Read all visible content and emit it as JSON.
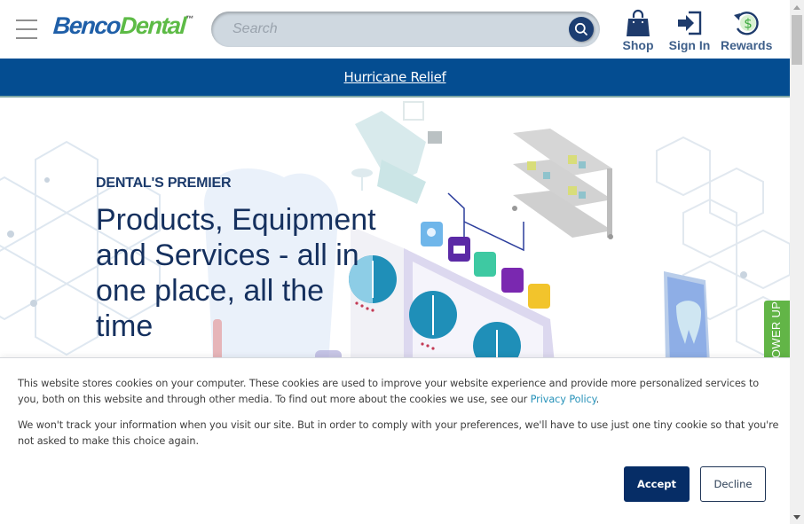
{
  "header": {
    "logo": {
      "part1": "Benco",
      "part2": "Dental",
      "trademark": "™"
    },
    "search": {
      "placeholder": "Search",
      "value": ""
    },
    "nav": [
      {
        "label": "Shop",
        "icon": "shopping-bag-icon"
      },
      {
        "label": "Sign In",
        "icon": "sign-in-icon"
      },
      {
        "label": "Rewards",
        "icon": "rewards-dollar-icon"
      }
    ]
  },
  "banner": {
    "link_text": "Hurricane Relief"
  },
  "hero": {
    "kicker": "DENTAL'S PREMIER",
    "title": "Products, Equipment and Services - all in one place, all the time",
    "side_tab": "POWER UP"
  },
  "cookie_notice": {
    "paragraph1_text": "This website stores cookies on your computer. These cookies are used to improve your website experience and provide more personalized services to you, both on this website and through other media. To find out more about the cookies we use, see our ",
    "privacy_link": "Privacy Policy",
    "paragraph1_end": ".",
    "paragraph2": "We won't track your information when you visit our site. But in order to comply with your preferences, we'll have to use just one tiny cookie so that you're not asked to make this choice again.",
    "accept_label": "Accept",
    "decline_label": "Decline"
  },
  "colors": {
    "brand_blue": "#1f5fa8",
    "brand_green": "#5dbb46",
    "banner_blue": "#044d91",
    "accept_navy": "#062d66",
    "link_teal": "#2792b9",
    "powerup_green": "#62b547"
  }
}
